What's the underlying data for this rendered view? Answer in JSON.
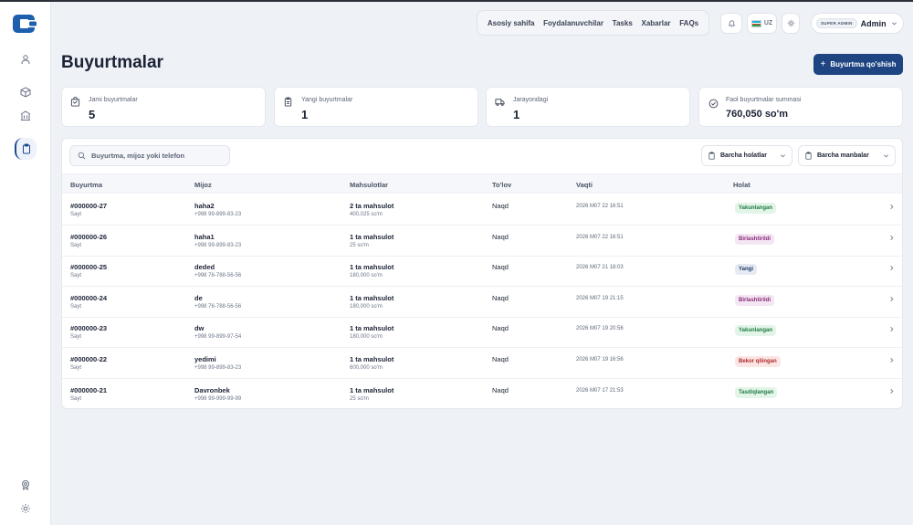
{
  "colors": {
    "primary": "#1e4582",
    "status": {
      "Yakunlangan": {
        "bg": "#e3f5e9",
        "fg": "#1f7a3f"
      },
      "Birlashtirildi": {
        "bg": "#f4e6f3",
        "fg": "#8a2a7a"
      },
      "Yangi": {
        "bg": "#e6ebf3",
        "fg": "#1e3c6b"
      },
      "Bekor qilingan": {
        "bg": "#fbe6e6",
        "fg": "#b42727"
      },
      "Tasdiqlangan": {
        "bg": "#e3f5e9",
        "fg": "#1f7a3f"
      }
    }
  },
  "sidebar": {
    "items": [
      {
        "icon": "users-icon"
      },
      {
        "icon": "box-icon"
      },
      {
        "icon": "building-icon"
      },
      {
        "icon": "clipboard-icon",
        "active": true
      },
      {
        "icon": "badge-icon"
      },
      {
        "icon": "settings-icon"
      }
    ]
  },
  "topnav": {
    "links": [
      "Asosiy sahifa",
      "Foydalanuvchilar",
      "Tasks",
      "Xabarlar",
      "FAQs"
    ],
    "lang": "UZ",
    "role": "SUPER ADMIN",
    "user": "Admin"
  },
  "page": {
    "title": "Buyurtmalar",
    "add_button": "Buyurtma qo'shish"
  },
  "stats": [
    {
      "label": "Jami buyurtmalar",
      "value": "5",
      "icon": "bag-icon"
    },
    {
      "label": "Yangi buyurtmalar",
      "value": "1",
      "icon": "clipboard-icon"
    },
    {
      "label": "Jarayondagi",
      "value": "1",
      "icon": "truck-icon"
    },
    {
      "label": "Faol buyurtmalar summasi",
      "value": "760,050 so'm",
      "icon": "check-circle-icon"
    }
  ],
  "table": {
    "search_placeholder": "Buyurtma, mijoz yoki telefon",
    "filters": [
      "Barcha holatlar",
      "Barcha manbalar"
    ],
    "columns": [
      "Buyurtma",
      "Mijoz",
      "Mahsulotlar",
      "To'lov",
      "Vaqti",
      "Holat"
    ],
    "rows": [
      {
        "id": "#000000-27",
        "source": "Sayt",
        "client": "haha2",
        "phone": "+998 99-899-83-23",
        "products": "2 ta mahsulot",
        "amount": "400,025 so'm",
        "payment": "Naqd",
        "time": "2026 M07 22 16:51",
        "status": "Yakunlangan"
      },
      {
        "id": "#000000-26",
        "source": "Sayt",
        "client": "haha1",
        "phone": "+998 99-899-83-23",
        "products": "1 ta mahsulot",
        "amount": "25 so'm",
        "payment": "Naqd",
        "time": "2026 M07 22 16:51",
        "status": "Birlashtirildi"
      },
      {
        "id": "#000000-25",
        "source": "Sayt",
        "client": "deded",
        "phone": "+998 76-788-56-56",
        "products": "1 ta mahsulot",
        "amount": "180,000 so'm",
        "payment": "Naqd",
        "time": "2026 M07 21 18:03",
        "status": "Yangi"
      },
      {
        "id": "#000000-24",
        "source": "Sayt",
        "client": "de",
        "phone": "+998 76-788-56-56",
        "products": "1 ta mahsulot",
        "amount": "180,000 so'm",
        "payment": "Naqd",
        "time": "2026 M07 19 21:15",
        "status": "Birlashtirildi"
      },
      {
        "id": "#000000-23",
        "source": "Sayt",
        "client": "dw",
        "phone": "+998 99-899-97-54",
        "products": "1 ta mahsulot",
        "amount": "180,000 so'm",
        "payment": "Naqd",
        "time": "2026 M07 19 20:56",
        "status": "Yakunlangan"
      },
      {
        "id": "#000000-22",
        "source": "Sayt",
        "client": "yedimi",
        "phone": "+998 99-899-83-23",
        "products": "1 ta mahsulot",
        "amount": "600,000 so'm",
        "payment": "Naqd",
        "time": "2026 M07 19 16:56",
        "status": "Bekor qilingan"
      },
      {
        "id": "#000000-21",
        "source": "Sayt",
        "client": "Davronbek",
        "phone": "+998 99-999-99-99",
        "products": "1 ta mahsulot",
        "amount": "25 so'm",
        "payment": "Naqd",
        "time": "2026 M07 17 21:53",
        "status": "Tasdiqlangan"
      }
    ]
  }
}
